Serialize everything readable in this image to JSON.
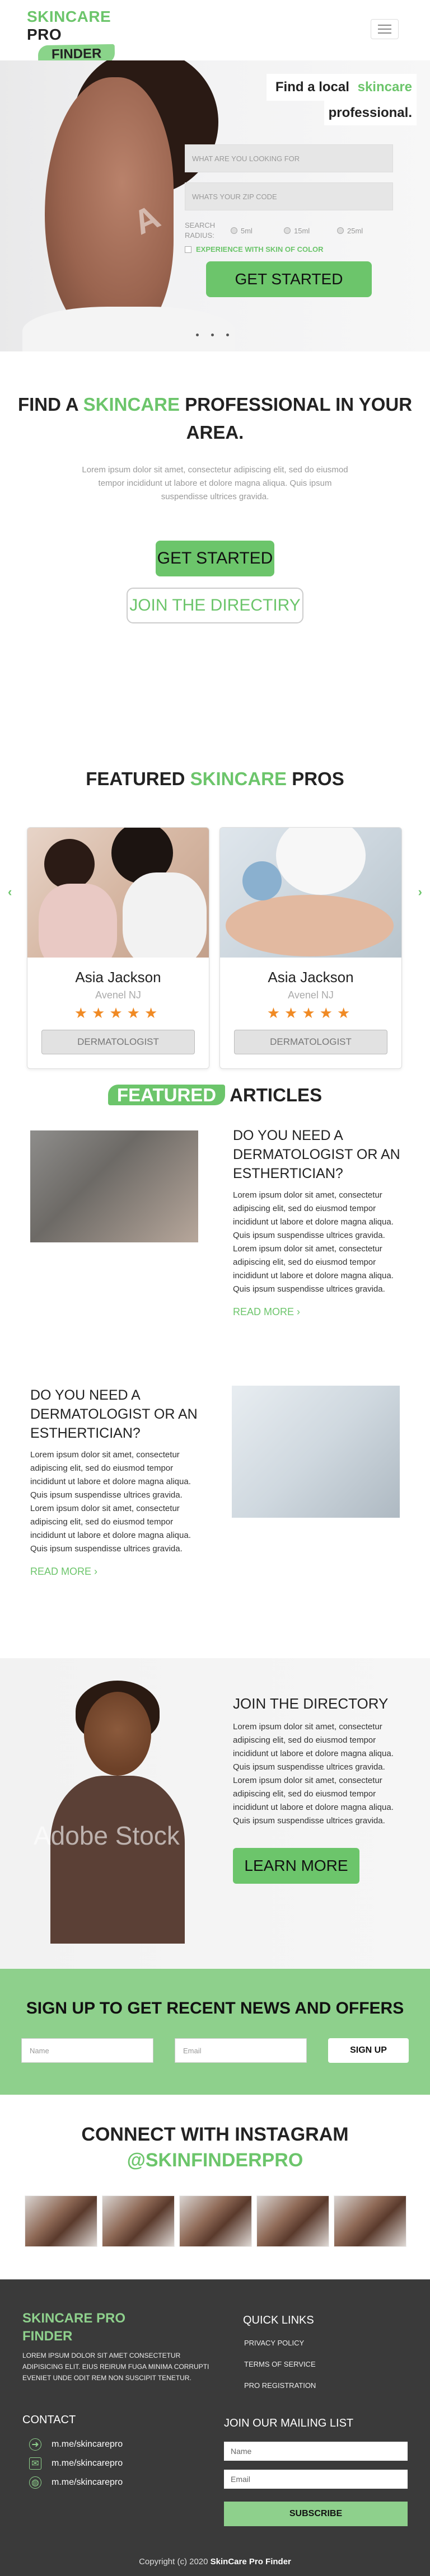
{
  "header": {
    "logo_line1_green": "SKINCARE",
    "logo_line1_dark": "PRO",
    "logo_line2": "FINDER"
  },
  "hero": {
    "title_prefix": "Find a local",
    "title_accent": "skincare",
    "title_line2": "professional.",
    "search_placeholder": "WHAT ARE YOU LOOKING FOR",
    "zip_placeholder": "WHATS YOUR ZIP CODE",
    "radius_label": "SEARCH RADIUS:",
    "radius_options": [
      "5ml",
      "15ml",
      "25ml"
    ],
    "checkbox_label": "EXPERIENCE WITH SKIN OF COLOR",
    "cta": "GET STARTED",
    "watermark": "A"
  },
  "find": {
    "title_prefix": "FIND A",
    "title_accent": "SKINCARE",
    "title_suffix": "PROFESSIONAL IN YOUR AREA.",
    "body": "Lorem ipsum dolor sit amet, consectetur adipiscing elit, sed do eiusmod tempor incididunt ut labore et dolore magna aliqua. Quis ipsum suspendisse ultrices gravida.",
    "btn_primary": "GET STARTED",
    "btn_secondary": "JOIN THE DIRECTIRY"
  },
  "pros": {
    "title_prefix": "FEATURED",
    "title_accent": "SKINCARE",
    "title_suffix": "PROS",
    "cards": [
      {
        "name": "Asia Jackson",
        "location": "Avenel NJ",
        "rating": 5,
        "role": "DERMATOLOGIST"
      },
      {
        "name": "Asia Jackson",
        "location": "Avenel NJ",
        "rating": 5,
        "role": "DERMATOLOGIST"
      }
    ],
    "stars": "★★★★★",
    "prev": "‹",
    "next": "›"
  },
  "articles": {
    "title_badge": "FEATURED",
    "title_rest": "ARTICLES",
    "items": [
      {
        "heading": "DO YOU NEED A DERMATOLOGIST OR AN ESTHERTICIAN?",
        "body": "Lorem ipsum dolor sit amet, consectetur adipiscing elit, sed do eiusmod tempor incididunt ut labore et dolore magna aliqua. Quis ipsum suspendisse ultrices gravida. Lorem ipsum dolor sit amet, consectetur adipiscing elit, sed do eiusmod tempor incididunt ut labore et dolore magna aliqua. Quis ipsum suspendisse ultrices gravida.",
        "more": "READ MORE ›"
      },
      {
        "heading": "DO YOU NEED A DERMATOLOGIST OR AN ESTHERTICIAN?",
        "body": "Lorem ipsum dolor sit amet, consectetur adipiscing elit, sed do eiusmod tempor incididunt ut labore et dolore magna aliqua. Quis ipsum suspendisse ultrices gravida. Lorem ipsum dolor sit amet, consectetur adipiscing elit, sed do eiusmod tempor incididunt ut labore et dolore magna aliqua. Quis ipsum suspendisse ultrices gravida.",
        "more": "READ MORE ›"
      }
    ]
  },
  "join": {
    "title": "JOIN THE DIRECTORY",
    "body": "Lorem ipsum dolor sit amet, consectetur adipiscing elit, sed do eiusmod tempor incididunt ut labore et dolore magna aliqua. Quis ipsum suspendisse ultrices gravida. Lorem ipsum dolor sit amet, consectetur adipiscing elit, sed do eiusmod tempor incididunt ut labore et dolore magna aliqua. Quis ipsum suspendisse ultrices gravida.",
    "cta": "LEARN MORE",
    "watermark": "Adobe Stock"
  },
  "newsletter": {
    "title": "SIGN UP TO GET RECENT NEWS AND OFFERS",
    "name_placeholder": "Name",
    "email_placeholder": "Email",
    "cta": "SIGN UP"
  },
  "instagram": {
    "title": "CONNECT WITH INSTAGRAM",
    "handle": "@SKINFINDERPRO"
  },
  "footer": {
    "logo_line1": "SKINCARE PRO",
    "logo_line2": "FINDER",
    "about": "LOREM IPSUM DOLOR SIT AMET CONSECTETUR ADIPISICING ELIT. EIUS REIRUM FUGA MINIMA CORRUPTI EVENIET UNDE ODIT REM NON SUSCIPIT TENETUR.",
    "quick_links_title": "QUICK LINKS",
    "links": [
      "PRIVACY POLICY",
      "TERMS OF SERVICE",
      "PRO REGISTRATION"
    ],
    "contact_title": "CONTACT",
    "contacts": [
      "m.me/skincarepro",
      "m.me/skincarepro",
      "m.me/skincarepro"
    ],
    "mailing_title": "JOIN OUR MAILING LIST",
    "mail_name_placeholder": "Name",
    "mail_email_placeholder": "Email",
    "subscribe": "SUBSCRIBE",
    "copyright_prefix": "Copyright (c) 2020",
    "copyright_brand": "SkinCare Pro Finder"
  },
  "colors": {
    "accent_green": "#6cc56b",
    "light_green": "#8ed08c",
    "star_orange": "#f08a24",
    "footer_bg": "#3a3a3a"
  },
  "icons": [
    "menu-icon",
    "chevron-left-icon",
    "chevron-right-icon",
    "star-icon",
    "messenger-icon",
    "mail-icon",
    "globe-icon"
  ]
}
